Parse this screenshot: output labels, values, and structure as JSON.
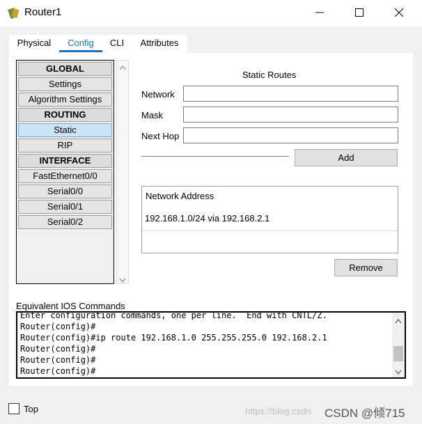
{
  "window": {
    "title": "Router1",
    "icon": "router-icon",
    "controls": {
      "minimize": "─",
      "maximize": "☐",
      "close": "✕"
    }
  },
  "tabs": [
    {
      "label": "Physical",
      "active": false
    },
    {
      "label": "Config",
      "active": true
    },
    {
      "label": "CLI",
      "active": false
    },
    {
      "label": "Attributes",
      "active": false
    }
  ],
  "sidebar": {
    "items": [
      {
        "label": "GLOBAL",
        "type": "header"
      },
      {
        "label": "Settings",
        "type": "item"
      },
      {
        "label": "Algorithm Settings",
        "type": "item"
      },
      {
        "label": "ROUTING",
        "type": "header"
      },
      {
        "label": "Static",
        "type": "item",
        "selected": true
      },
      {
        "label": "RIP",
        "type": "item"
      },
      {
        "label": "INTERFACE",
        "type": "header"
      },
      {
        "label": "FastEthernet0/0",
        "type": "item"
      },
      {
        "label": "Serial0/0",
        "type": "item"
      },
      {
        "label": "Serial0/1",
        "type": "item"
      },
      {
        "label": "Serial0/2",
        "type": "item"
      }
    ]
  },
  "static_routes": {
    "title": "Static Routes",
    "network_label": "Network",
    "network_value": "",
    "mask_label": "Mask",
    "mask_value": "",
    "next_hop_label": "Next Hop",
    "next_hop_value": "",
    "add_label": "Add",
    "table_header": "Network Address",
    "rows": [
      "192.168.1.0/24 via 192.168.2.1"
    ],
    "remove_label": "Remove"
  },
  "ios": {
    "label": "Equivalent IOS Commands",
    "lines": [
      "Enter configuration commands, one per line.  End with CNTL/Z.",
      "Router(config)#",
      "Router(config)#ip route 192.168.1.0 255.255.255.0 192.168.2.1",
      "Router(config)#",
      "Router(config)#",
      "Router(config)#"
    ]
  },
  "footer": {
    "top_label": "Top",
    "top_checked": false,
    "watermark_faint": "https://blog.csdn",
    "watermark": "CSDN @倾715"
  },
  "colors": {
    "accent": "#1b72c4",
    "selected_bg": "#cce4f7"
  }
}
